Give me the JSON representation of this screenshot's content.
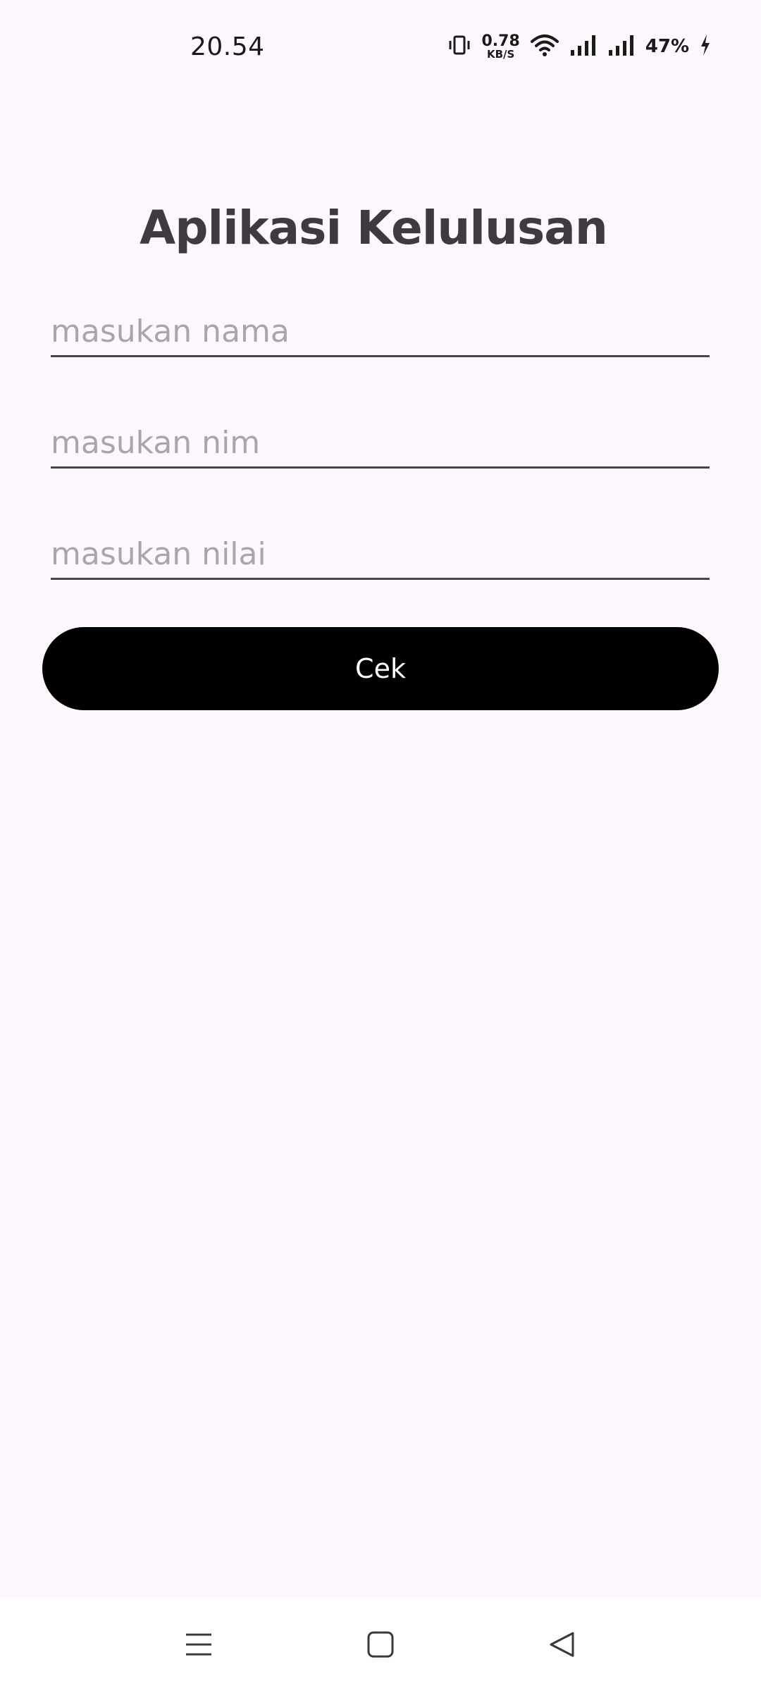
{
  "status_bar": {
    "time": "20.54",
    "net_speed_value": "0.78",
    "net_speed_unit": "KB/S",
    "battery_percent": "47%",
    "icons": [
      "vibrate-icon",
      "wifi-icon",
      "signal-icon",
      "signal-icon",
      "charging-icon"
    ]
  },
  "app": {
    "title": "Aplikasi Kelulusan"
  },
  "form": {
    "name_placeholder": "masukan nama",
    "nim_placeholder": "masukan nim",
    "nilai_placeholder": "masukan nilai",
    "name_value": "",
    "nim_value": "",
    "nilai_value": "",
    "submit_label": "Cek"
  },
  "nav_bar": {
    "icons": [
      "menu-icon",
      "home-icon",
      "back-icon"
    ]
  },
  "colors": {
    "background": "#fdf7fd",
    "button": "#000000",
    "title": "#3f3a40",
    "placeholder": "#a9a5ab"
  }
}
